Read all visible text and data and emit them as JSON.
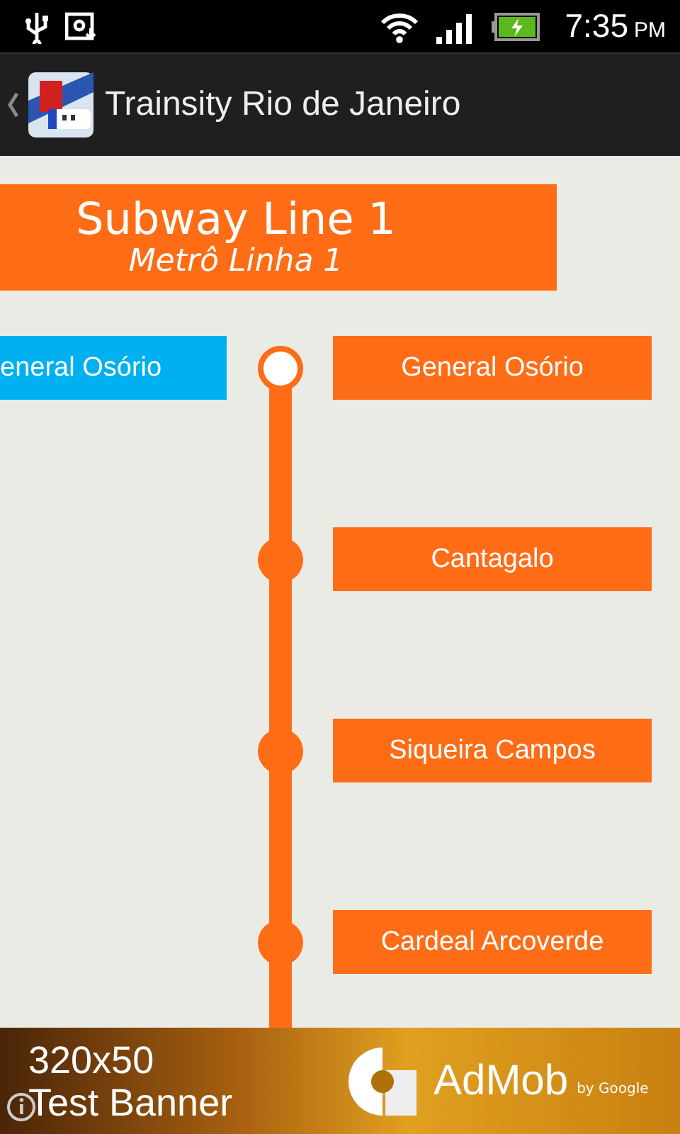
{
  "status_bar": {
    "time": "7:35",
    "period": "PM"
  },
  "action_bar": {
    "title": "Trainsity Rio de Janeiro"
  },
  "line": {
    "title": "Subway Line 1",
    "subtitle": "Metrô Linha 1"
  },
  "stations": [
    {
      "name": "General Osório",
      "selected": true,
      "connection_label": "eneral Osório"
    },
    {
      "name": "Cantagalo",
      "selected": false
    },
    {
      "name": "Siqueira Campos",
      "selected": false
    },
    {
      "name": "Cardeal Arcoverde",
      "selected": false
    }
  ],
  "ad_banner": {
    "size": "320x50",
    "label": "Test Banner",
    "brand": "AdMob",
    "byline": "by Google"
  }
}
